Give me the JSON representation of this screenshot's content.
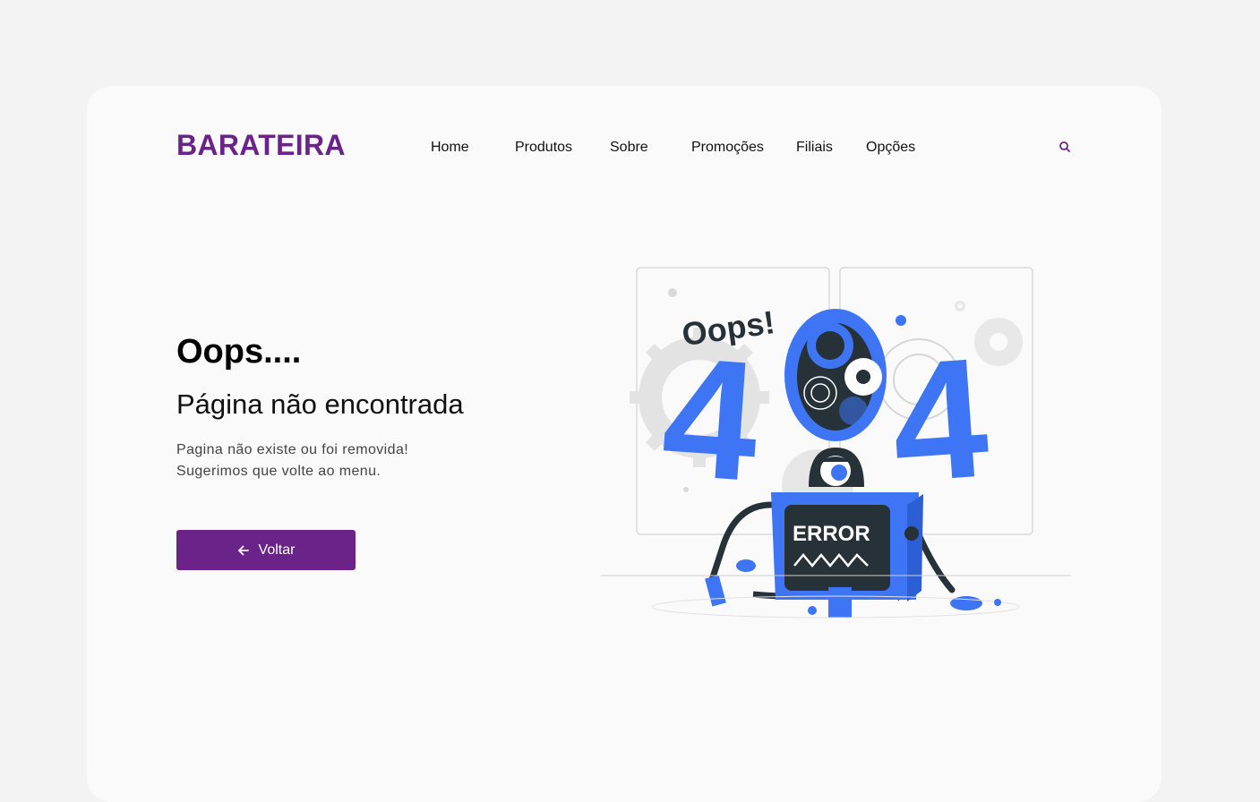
{
  "brand": {
    "name": "BARATEIRA"
  },
  "nav": {
    "items": [
      {
        "label": "Home"
      },
      {
        "label": "Produtos"
      },
      {
        "label": "Sobre"
      },
      {
        "label": "Promoções"
      },
      {
        "label": "Filiais"
      },
      {
        "label": "Opções"
      }
    ],
    "search_icon": "search-icon"
  },
  "hero": {
    "title": "Oops....",
    "subtitle": "Página não encontrada",
    "description_line1": "Pagina não existe ou foi removida!",
    "description_line2": "Sugerimos que volte ao menu.",
    "back_button": {
      "label": "Voltar",
      "icon": "arrow-left-icon"
    }
  },
  "illustration": {
    "oops_text": "Oops!",
    "error_text": "ERROR",
    "digits": [
      "4",
      "0",
      "4"
    ]
  },
  "colors": {
    "brand": "#6a2388",
    "accent_blue": "#3e75f5",
    "dark": "#263238",
    "background": "#f3f3f3",
    "card": "#fafafa"
  }
}
